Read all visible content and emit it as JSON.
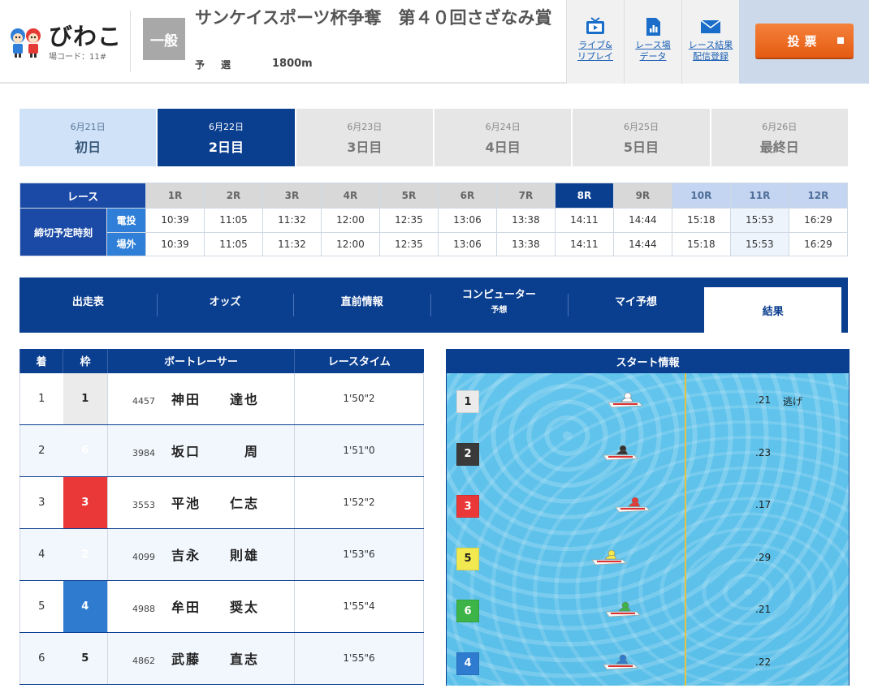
{
  "header": {
    "venue_name": "びわこ",
    "venue_code": "場コード：11#",
    "grade": "一般",
    "race_title": "サンケイスポーツ杯争奪　第４０回さざなみ賞",
    "race_type": "予　選",
    "distance": "1800m",
    "links": [
      {
        "label": "ライブ&\nリプレイ",
        "icon": "tv-icon"
      },
      {
        "label": "レース場\nデータ",
        "icon": "chart-doc-icon"
      },
      {
        "label": "レース結果\n配信登録",
        "icon": "mail-icon"
      }
    ],
    "vote_label": "投票"
  },
  "days": [
    {
      "date": "6月21日",
      "label": "初日",
      "state": "past"
    },
    {
      "date": "6月22日",
      "label": "2日目",
      "state": "active"
    },
    {
      "date": "6月23日",
      "label": "3日目",
      "state": "future"
    },
    {
      "date": "6月24日",
      "label": "4日目",
      "state": "future"
    },
    {
      "date": "6月25日",
      "label": "5日目",
      "state": "future"
    },
    {
      "date": "6月26日",
      "label": "最終日",
      "state": "future"
    }
  ],
  "schedule": {
    "race_header": "レース",
    "close_header": "締切予定時刻",
    "row1_label": "電投",
    "row2_label": "場外",
    "races": [
      "1R",
      "2R",
      "3R",
      "4R",
      "5R",
      "6R",
      "7R",
      "8R",
      "9R",
      "10R",
      "11R",
      "12R"
    ],
    "race_states": [
      "done",
      "done",
      "done",
      "done",
      "done",
      "done",
      "done",
      "cur",
      "done",
      "fut",
      "fut",
      "fut"
    ],
    "times_denpyo": [
      "10:39",
      "11:05",
      "11:32",
      "12:00",
      "12:35",
      "13:06",
      "13:38",
      "14:11",
      "14:44",
      "15:18",
      "15:53",
      "16:29"
    ],
    "times_jogai": [
      "10:39",
      "11:05",
      "11:32",
      "12:00",
      "12:35",
      "13:06",
      "13:38",
      "14:11",
      "14:44",
      "15:18",
      "15:53",
      "16:29"
    ]
  },
  "nav": {
    "tabs": [
      {
        "label": "出走表",
        "sub": ""
      },
      {
        "label": "オッズ",
        "sub": ""
      },
      {
        "label": "直前情報",
        "sub": ""
      },
      {
        "label": "コンピューター",
        "sub": "予想"
      },
      {
        "label": "マイ予想",
        "sub": ""
      },
      {
        "label": "結果",
        "sub": ""
      }
    ],
    "active_index": 5
  },
  "results": {
    "headers": [
      "着",
      "枠",
      "ボートレーサー",
      "レースタイム"
    ],
    "rows": [
      {
        "rank": "1",
        "waku": "1",
        "reg": "4457",
        "name": "神田　　達也",
        "time": "1'50\"2"
      },
      {
        "rank": "2",
        "waku": "6",
        "reg": "3984",
        "name": "坂口　　　周",
        "time": "1'51\"0"
      },
      {
        "rank": "3",
        "waku": "3",
        "reg": "3553",
        "name": "平池　　仁志",
        "time": "1'52\"2"
      },
      {
        "rank": "4",
        "waku": "2",
        "reg": "4099",
        "name": "吉永　　則雄",
        "time": "1'53\"6"
      },
      {
        "rank": "5",
        "waku": "4",
        "reg": "4988",
        "name": "牟田　　奨太",
        "time": "1'55\"4"
      },
      {
        "rank": "6",
        "waku": "5",
        "reg": "4862",
        "name": "武藤　　直志",
        "time": "1'55\"6"
      }
    ]
  },
  "start": {
    "title": "スタート情報",
    "rows": [
      {
        "lane": "1",
        "st": ".21",
        "note": "逃げ",
        "boat_offset": 0.81
      },
      {
        "lane": "2",
        "st": ".23",
        "note": "",
        "boat_offset": 0.79
      },
      {
        "lane": "3",
        "st": ".17",
        "note": "",
        "boat_offset": 0.84
      },
      {
        "lane": "5",
        "st": ".29",
        "note": "",
        "boat_offset": 0.74
      },
      {
        "lane": "6",
        "st": ".21",
        "note": "",
        "boat_offset": 0.8
      },
      {
        "lane": "4",
        "st": ".22",
        "note": "",
        "boat_offset": 0.79
      }
    ]
  },
  "colors": {
    "navy": "#0a3e8f",
    "w1": "#ebebeb",
    "w2": "#3a3a3a",
    "w3": "#ea3838",
    "w4": "#2e7bd0",
    "w5": "#f1e94f",
    "w6": "#3db447",
    "vote": "#ee6d25"
  }
}
